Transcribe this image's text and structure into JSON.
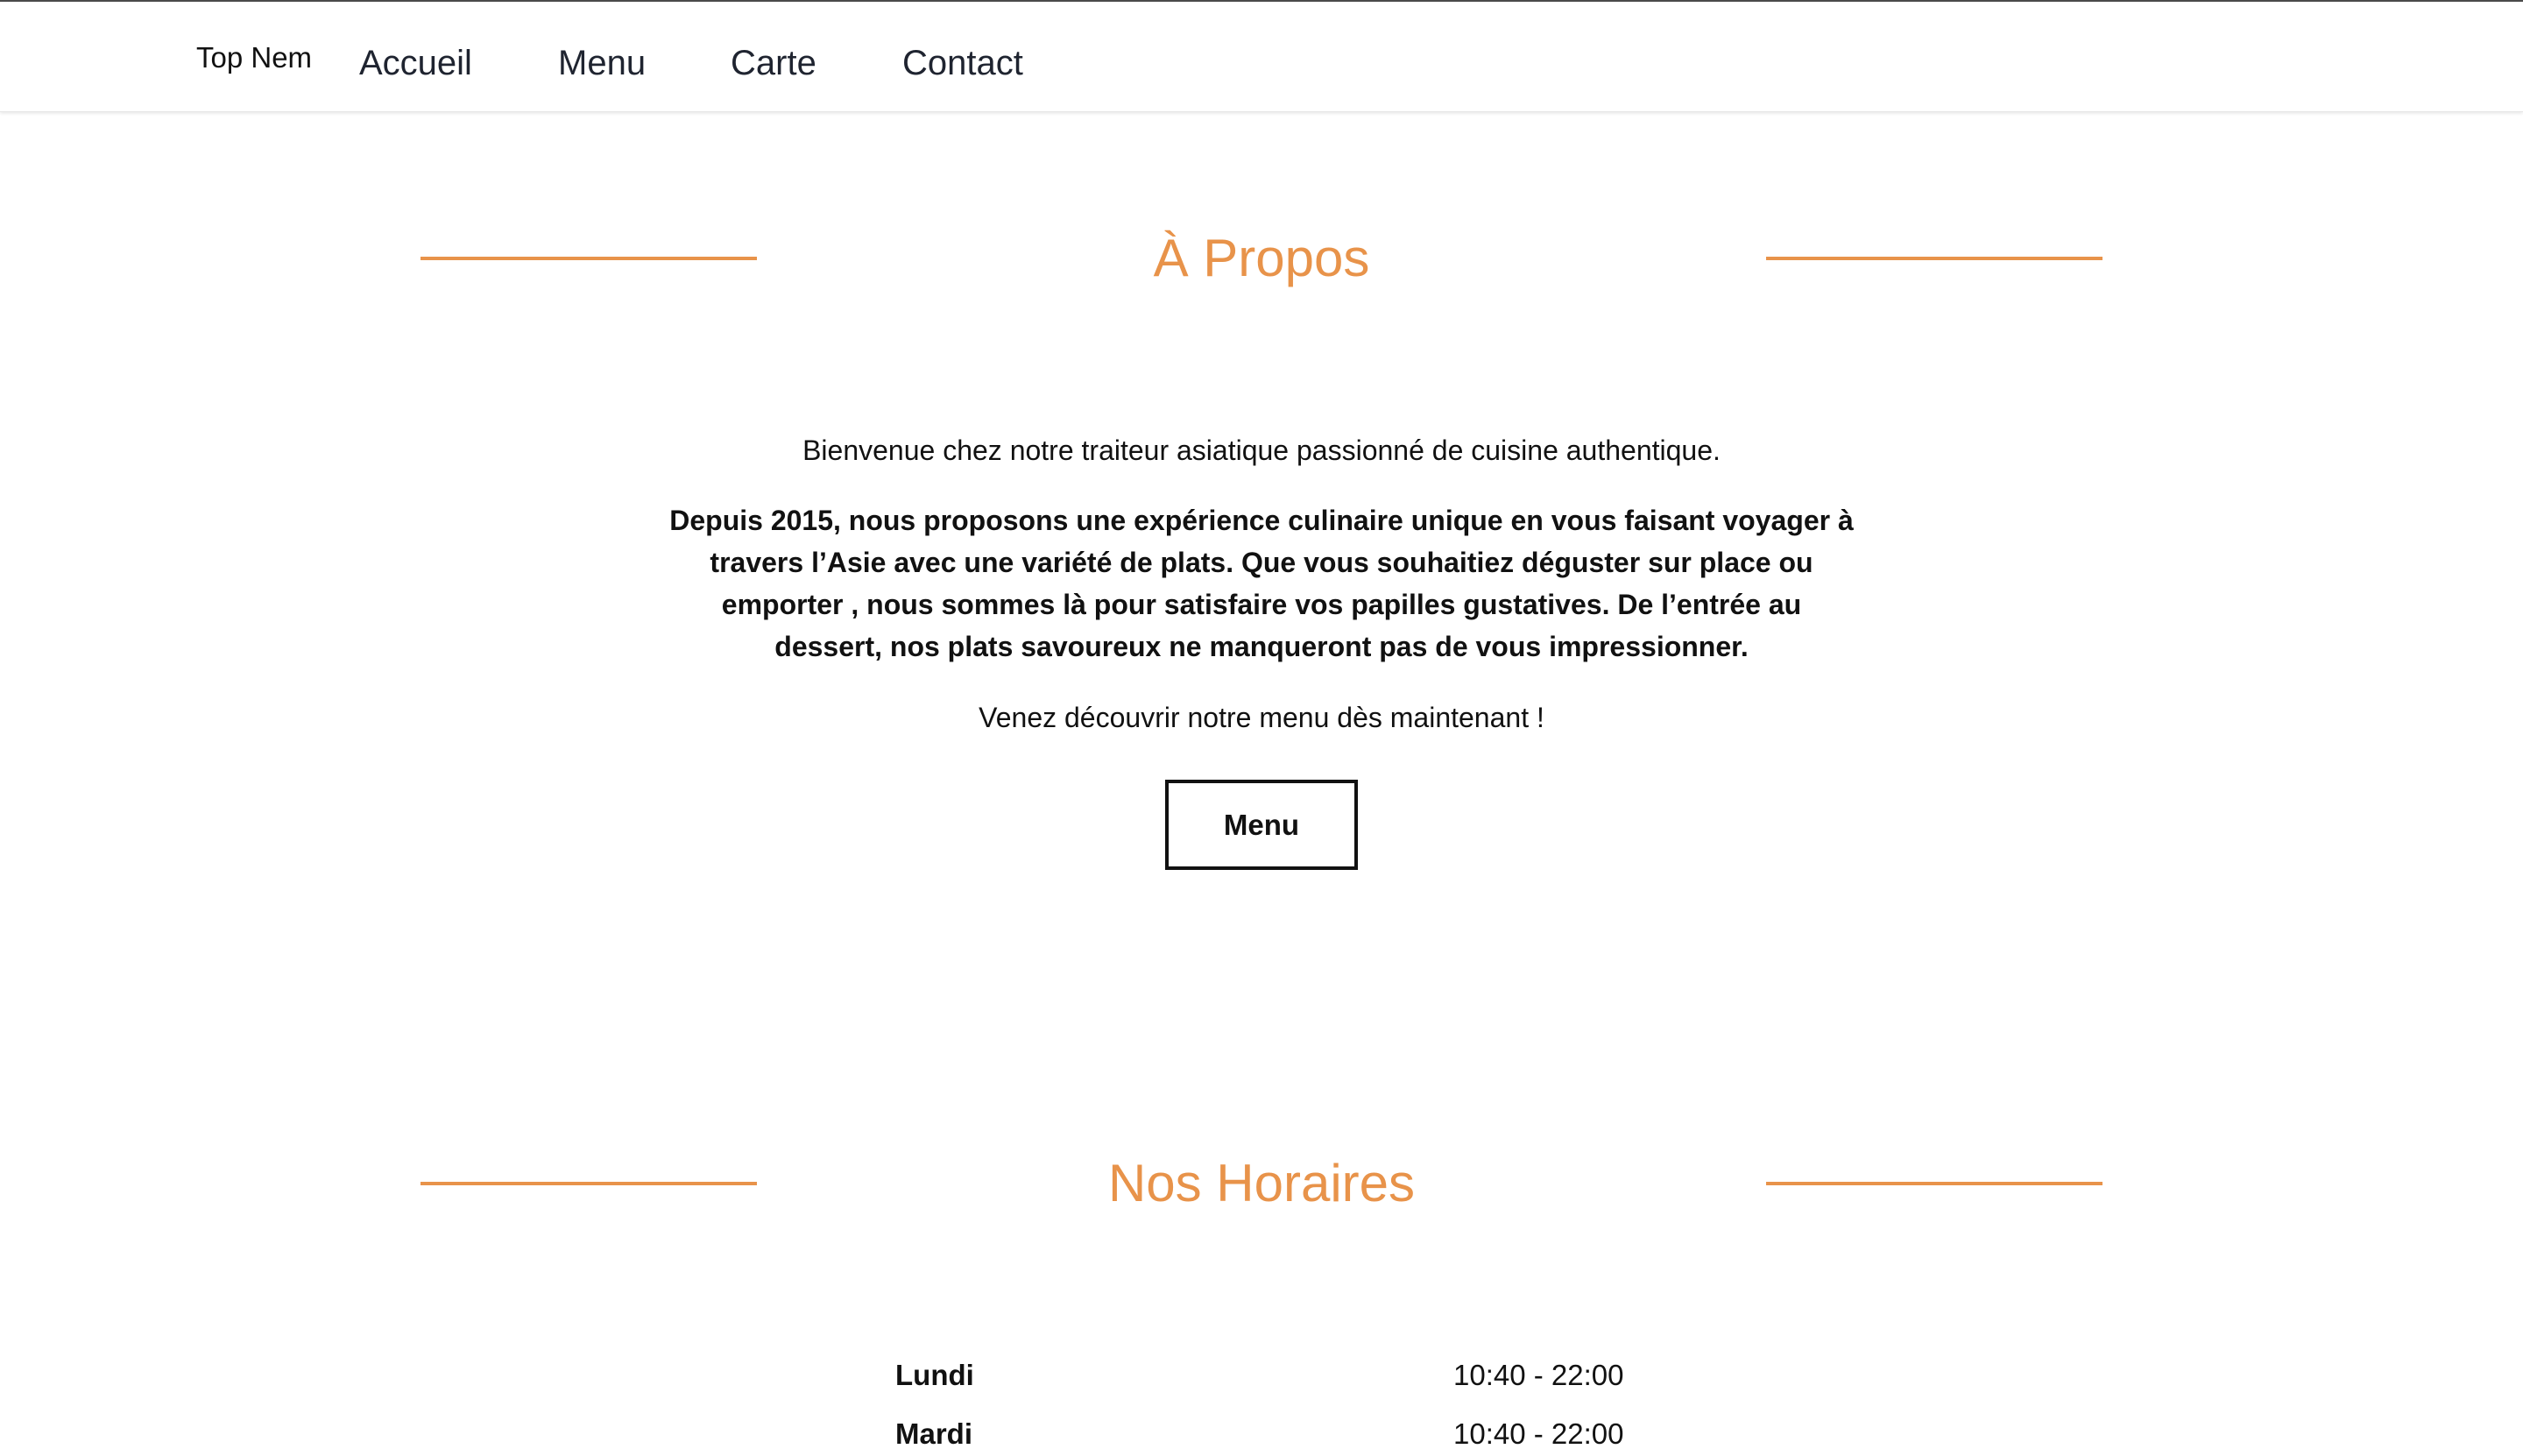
{
  "nav": {
    "brand": "Top Nem",
    "links": [
      "Accueil",
      "Menu",
      "Carte",
      "Contact"
    ]
  },
  "about": {
    "title": "À Propos",
    "intro": "Bienvenue chez notre traiteur asiatique passionné de cuisine authentique.",
    "history": "Depuis 2015, nous proposons une expérience culinaire unique en vous faisant voyager à travers l’Asie avec une variété de plats. Que vous souhaitiez déguster sur place ou emporter , nous sommes là pour satisfaire vos papilles gustatives. De l’entrée au dessert, nos plats savoureux ne manqueront pas de vous impressionner.",
    "cta": "Venez découvrir notre menu dès maintenant !",
    "button_label": "Menu"
  },
  "hours": {
    "title": "Nos Horaires",
    "rows": [
      {
        "day": "Lundi",
        "time": "10:40 - 22:00"
      },
      {
        "day": "Mardi",
        "time": "10:40 - 22:00"
      }
    ]
  },
  "colors": {
    "accent": "#e8934a",
    "text": "#111111",
    "nav_text": "#1f2430"
  }
}
